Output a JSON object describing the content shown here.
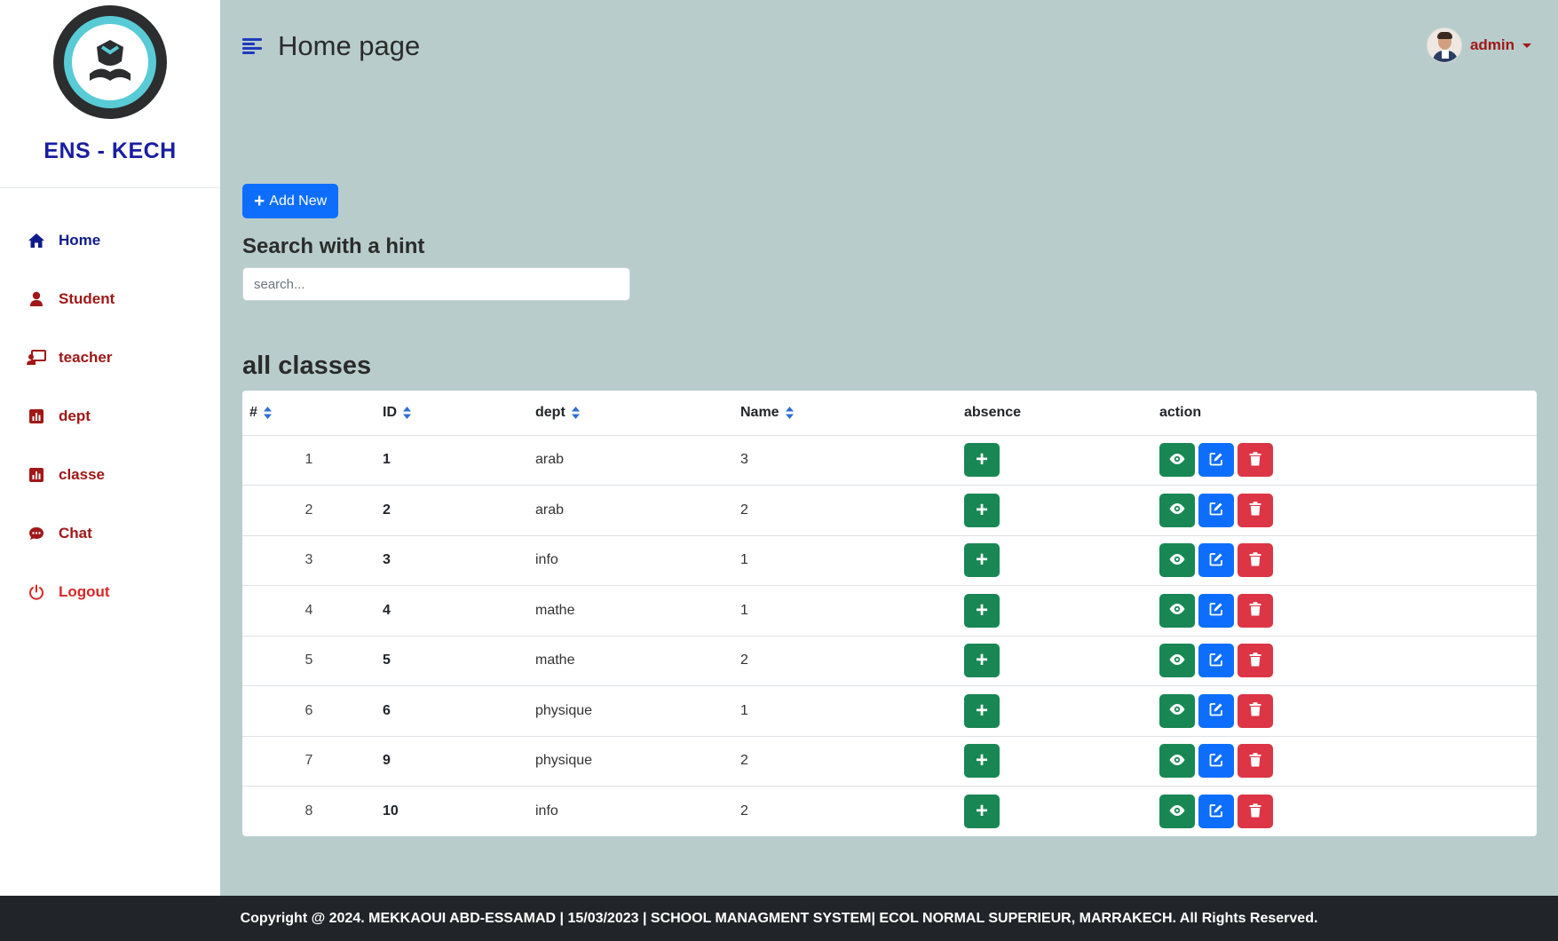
{
  "sidebar": {
    "brand": "ENS - KECH",
    "items": [
      {
        "label": "Home",
        "icon": "home-icon"
      },
      {
        "label": "Student",
        "icon": "user-icon"
      },
      {
        "label": "teacher",
        "icon": "chalkboard-teacher-icon"
      },
      {
        "label": "dept",
        "icon": "chart-bar-icon"
      },
      {
        "label": "classe",
        "icon": "chart-bar-icon"
      },
      {
        "label": "Chat",
        "icon": "comment-icon"
      },
      {
        "label": "Logout",
        "icon": "power-icon"
      }
    ]
  },
  "header": {
    "title": "Home page",
    "user_name": "admin"
  },
  "toolbar": {
    "add_new_label": "Add New",
    "search_title": "Search with a hint",
    "search_placeholder": "search..."
  },
  "table": {
    "title": "all classes",
    "columns": [
      "#",
      "ID",
      "dept",
      "Name",
      "absence",
      "action"
    ],
    "rows": [
      {
        "idx": "1",
        "id": "1",
        "dept": "arab",
        "name": "3"
      },
      {
        "idx": "2",
        "id": "2",
        "dept": "arab",
        "name": "2"
      },
      {
        "idx": "3",
        "id": "3",
        "dept": "info",
        "name": "1"
      },
      {
        "idx": "4",
        "id": "4",
        "dept": "mathe",
        "name": "1"
      },
      {
        "idx": "5",
        "id": "5",
        "dept": "mathe",
        "name": "2"
      },
      {
        "idx": "6",
        "id": "6",
        "dept": "physique",
        "name": "1"
      },
      {
        "idx": "7",
        "id": "9",
        "dept": "physique",
        "name": "2"
      },
      {
        "idx": "8",
        "id": "10",
        "dept": "info",
        "name": "2"
      }
    ]
  },
  "footer": {
    "text": "Copyright @ 2024. MEKKAOUI ABD-ESSAMAD | 15/03/2023 | SCHOOL MANAGMENT SYSTEM| ECOL NORMAL SUPERIEUR, MARRAKECH. All Rights Reserved."
  },
  "colors": {
    "brand_blue": "#1a1ea0",
    "nav_red": "#a01818",
    "background": "#b8cccc",
    "primary": "#0d6efd",
    "success": "#198754",
    "danger": "#dc3545"
  }
}
